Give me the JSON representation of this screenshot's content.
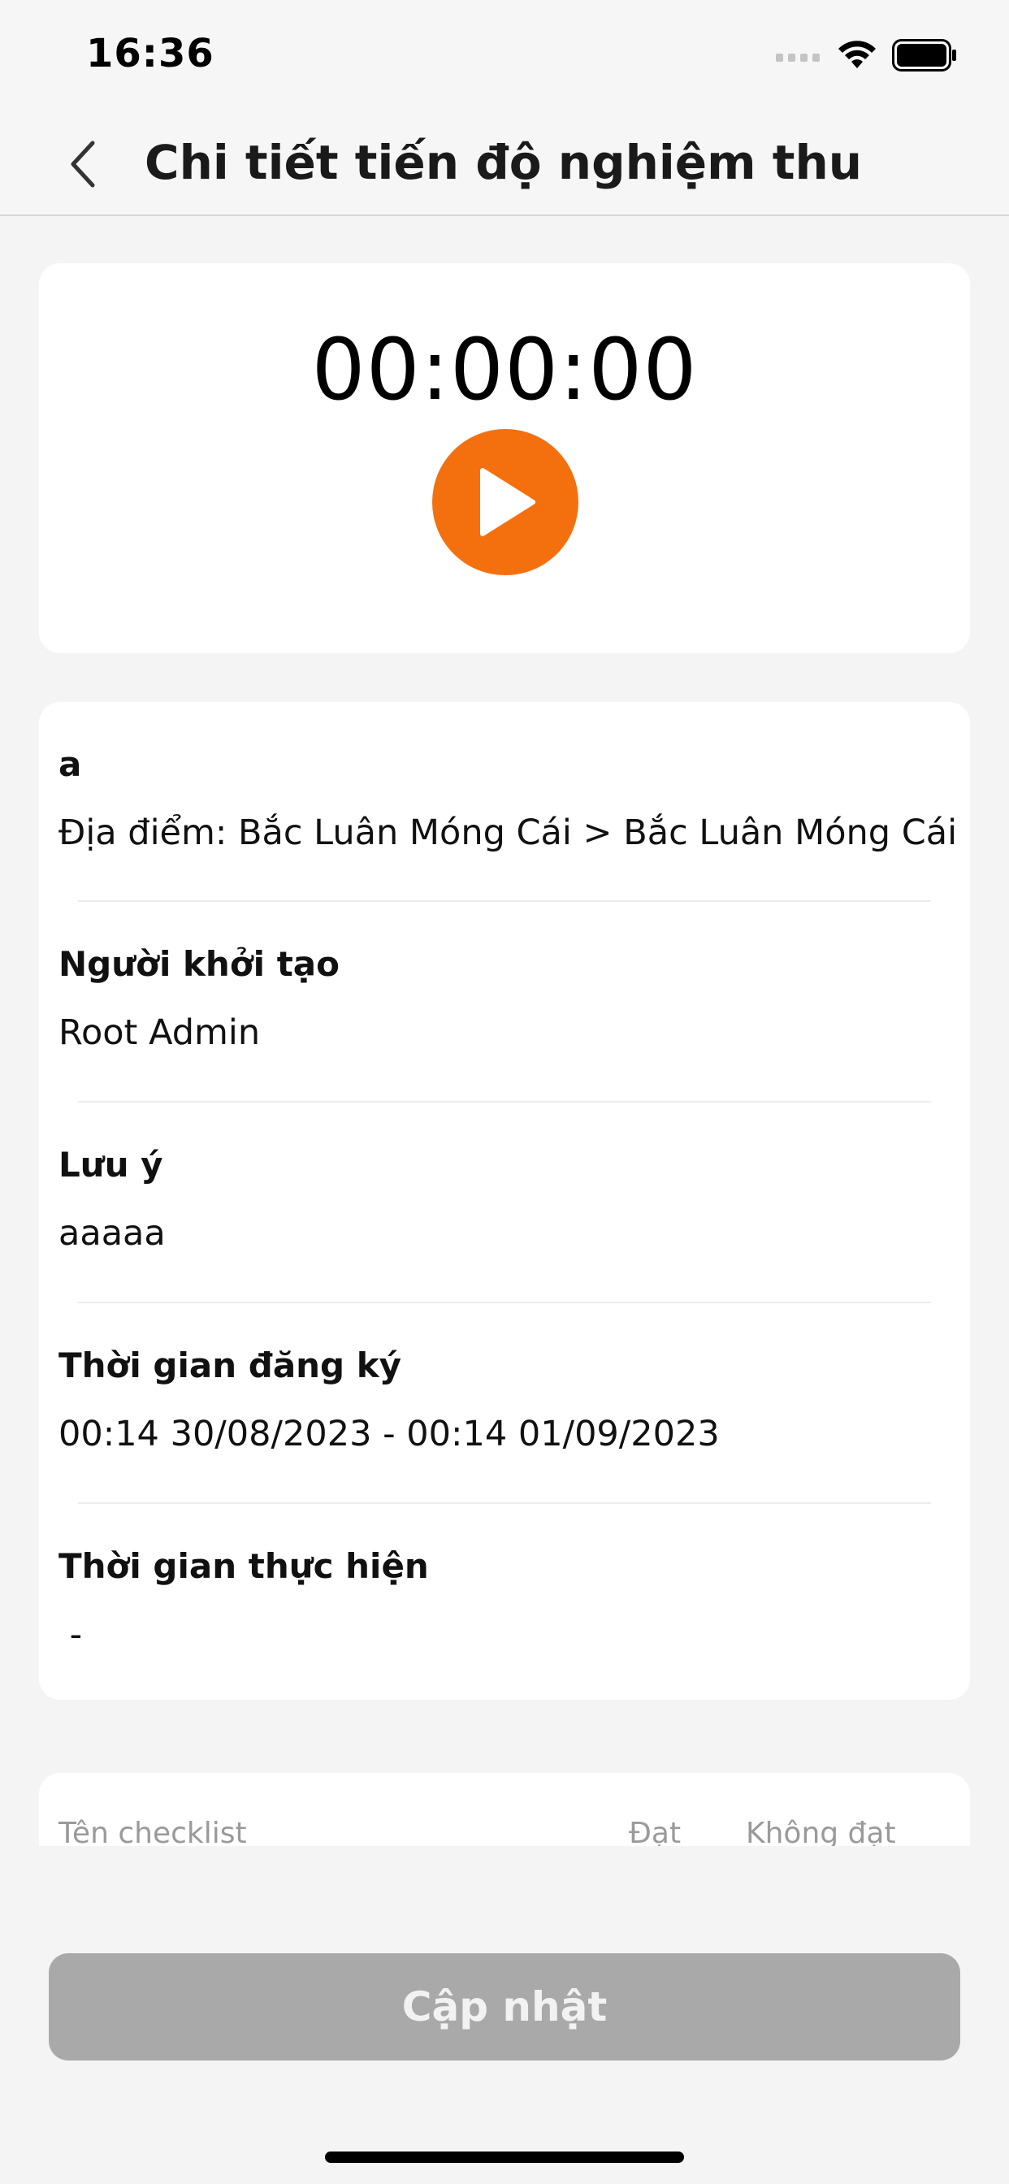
{
  "status_bar": {
    "time": "16:36"
  },
  "header": {
    "title": "Chi tiết tiến độ nghiệm thu",
    "back_icon": "chevron-left-icon"
  },
  "timer": {
    "display": "00:00:00",
    "play_icon": "play-icon",
    "accent_color": "#f4700f"
  },
  "details": {
    "name": "a",
    "location": "Địa điểm: Bắc Luân Móng Cái > Bắc Luân Móng Cái",
    "creator_label": "Người khởi tạo",
    "creator_value": "Root Admin",
    "note_label": "Lưu ý",
    "note_value": "aaaaa",
    "registered_time_label": "Thời gian đăng ký",
    "registered_time_value": "00:14 30/08/2023 - 00:14 01/09/2023",
    "actual_time_label": "Thời gian thực hiện",
    "actual_time_value": " -"
  },
  "checklist": {
    "columns": [
      "Tên checklist",
      "Đạt",
      "Không đạt"
    ]
  },
  "footer": {
    "update_label": "Cập nhật"
  }
}
